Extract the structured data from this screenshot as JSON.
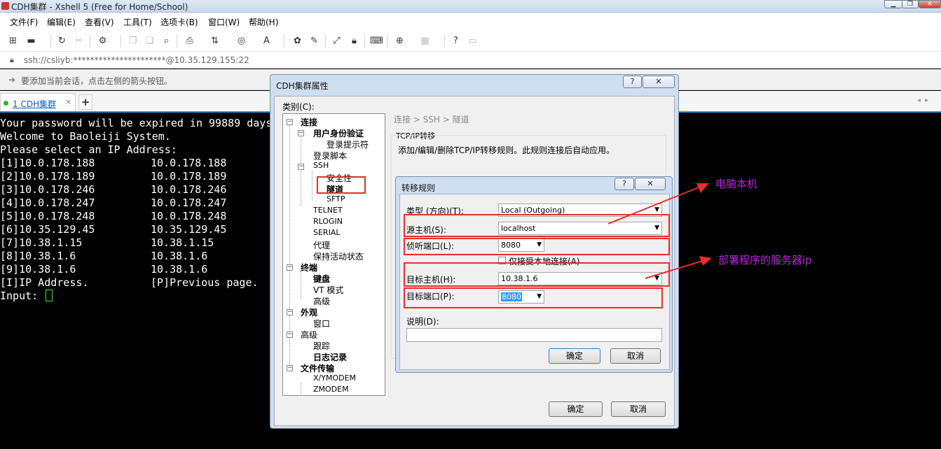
{
  "window": {
    "title": "CDH集群 - Xshell 5 (Free for Home/School)"
  },
  "menu": [
    "文件(F)",
    "编辑(E)",
    "查看(V)",
    "工具(T)",
    "选项卡(B)",
    "窗口(W)",
    "帮助(H)"
  ],
  "address": {
    "text": "ssh://csliyb:**********************@10.35.129.155:22"
  },
  "hint": {
    "text": "要添加当前会话，点击左侧的箭头按钮。"
  },
  "tabs": [
    {
      "label": "1 CDH集群",
      "close": "×"
    }
  ],
  "tab_add": "+",
  "terminal": {
    "lines": [
      "Your password will be expired in 99889 days",
      "Welcome to Baoleiji System.",
      "Please select an IP Address:"
    ],
    "ip_rows": [
      {
        "left": "[1]10.0.178.188",
        "right": "10.0.178.188"
      },
      {
        "left": "[2]10.0.178.189",
        "right": "10.0.178.189"
      },
      {
        "left": "[3]10.0.178.246",
        "right": "10.0.178.246"
      },
      {
        "left": "[4]10.0.178.247",
        "right": "10.0.178.247"
      },
      {
        "left": "[5]10.0.178.248",
        "right": "10.0.178.248"
      },
      {
        "left": "[6]10.35.129.45",
        "right": "10.35.129.45"
      },
      {
        "left": "[7]10.38.1.15",
        "right": "10.38.1.15"
      },
      {
        "left": "[8]10.38.1.6",
        "right": "10.38.1.6"
      },
      {
        "left": "[9]10.38.1.6",
        "right": "10.38.1.6"
      },
      {
        "left": "[I]IP Address.",
        "right": "[P]Previous page."
      }
    ],
    "prompt": "Input: "
  },
  "props_dialog": {
    "title": "CDH集群属性",
    "help": "?",
    "close": "✕",
    "category_label": "类别(C):",
    "tree": {
      "conn": "连接",
      "auth": "用户身份验证",
      "login_prompt": "登录提示符",
      "login_script": "登录脚本",
      "ssh": "SSH",
      "security": "安全性",
      "tunnel": "隧道",
      "sftp": "SFTP",
      "telnet": "TELNET",
      "rlogin": "RLOGIN",
      "serial": "SERIAL",
      "proxy": "代理",
      "keepalive": "保持活动状态",
      "terminal": "终端",
      "keyboard": "键盘",
      "vt": "VT 模式",
      "adv": "高级",
      "appearance": "外观",
      "window": "窗口",
      "advanced": "高级",
      "trace": "跟踪",
      "logging": "日志记录",
      "filetransfer": "文件传输",
      "xymodem": "X/YMODEM",
      "zmodem": "ZMODEM"
    },
    "breadcrumb": "连接 > SSH > 隧道",
    "group_title": "TCP/IP转移",
    "group_desc": "添加/编辑/删除TCP/IP转移规则。此规则连接后自动应用。",
    "ok": "确定",
    "cancel": "取消"
  },
  "rule_dialog": {
    "title": "转移规则",
    "help": "?",
    "close": "✕",
    "type_label": "类型 (方向)(T):",
    "type_value": "Local (Outgoing)",
    "src_host_label": "源主机(S):",
    "src_host_value": "localhost",
    "listen_port_label": "侦听端口(L):",
    "listen_port_value": "8080",
    "local_only_label": "仅接受本地连接(A)",
    "dst_host_label": "目标主机(H):",
    "dst_host_value": "10.38.1.6",
    "dst_port_label": "目标端口(P):",
    "dst_port_value": "8080",
    "desc_label": "说明(D):",
    "desc_value": "",
    "ok": "确定",
    "cancel": "取消"
  },
  "annotations": {
    "local_pc": "电脑本机",
    "server_ip": "部署程序的服务器ip",
    "color": "#b629d8",
    "box_color": "#e62e2e"
  }
}
